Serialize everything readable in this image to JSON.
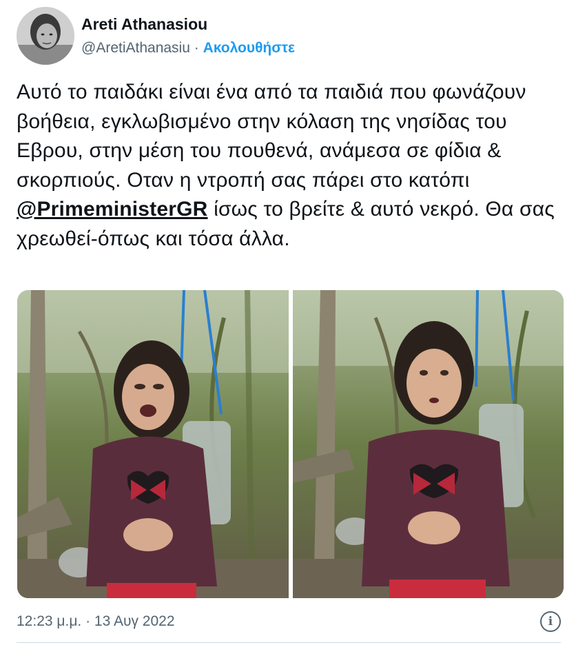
{
  "author": {
    "display_name": "Areti Athanasiou",
    "handle": "@AretiAthanasiu",
    "separator": "·",
    "follow_label": "Ακολουθήστε"
  },
  "tweet": {
    "text_before_mention": "Αυτό το παιδάκι είναι ένα από τα παιδιά που φωνάζουν βοήθεια, εγκλωβισμένο στην κόλαση της νησίδας του Εβρου, στην μέση του πουθενά, ανάμεσα σε φίδια & σκορπιούς. Οταν η ντροπή σας πάρει στο κατόπι ",
    "mention": "@PrimeministerGR",
    "text_after_mention": " ίσως το βρείτε & αυτό νεκρό. Θα σας χρεωθεί-όπως και τόσα άλλα.",
    "timestamp": "12:23 μ.μ. · 13 Αυγ 2022"
  },
  "icons": {
    "info": "info-icon",
    "avatar": "profile-photo"
  },
  "colors": {
    "accent": "#1d9bf0",
    "secondary_text": "#536471",
    "primary_text": "#0f1419",
    "divider": "#cfd9de"
  }
}
